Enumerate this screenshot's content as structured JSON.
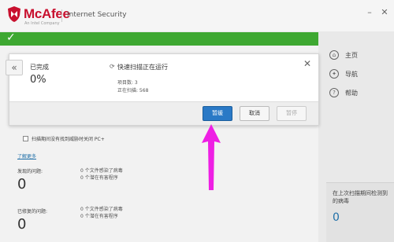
{
  "titlebar": {
    "brand": "McAfee",
    "brand_sub": "An Intel Company",
    "product": "Internet Security"
  },
  "nav": [
    {
      "label": "主页",
      "icon": "home-icon"
    },
    {
      "label": "导航",
      "icon": "compass-icon"
    },
    {
      "label": "帮助",
      "icon": "help-icon"
    }
  ],
  "info": {
    "label": "在上次扫描期间检测到的病毒",
    "value": "0"
  },
  "dialog": {
    "back_glyph": "«",
    "done_label": "已完成",
    "percent": "0%",
    "scan_title": "快速扫描正在运行",
    "items_scanned": "项目数: 3",
    "scanning": "正在扫描: 568",
    "close": "✕",
    "buttons": {
      "pause": "暂缓",
      "cancel": "取消",
      "stop": "暂停"
    }
  },
  "options": {
    "checkbox_label": "扫描期间没有找到威胁时关闭 PC+",
    "learn_more": "了解更多"
  },
  "found": {
    "label": "发现的问题:",
    "count": "0",
    "detail1": "0 个文件感染了病毒",
    "detail2": "0 个潜在有害程序"
  },
  "fixed": {
    "label": "已修复的问题:",
    "count": "0",
    "detail1": "0 个文件感染了病毒",
    "detail2": "0 个潜在有害程序"
  },
  "colors": {
    "brand": "#c8102e",
    "status": "#3ea832",
    "primary_button": "#2a79c6",
    "arrow": "#ee1fe4"
  }
}
